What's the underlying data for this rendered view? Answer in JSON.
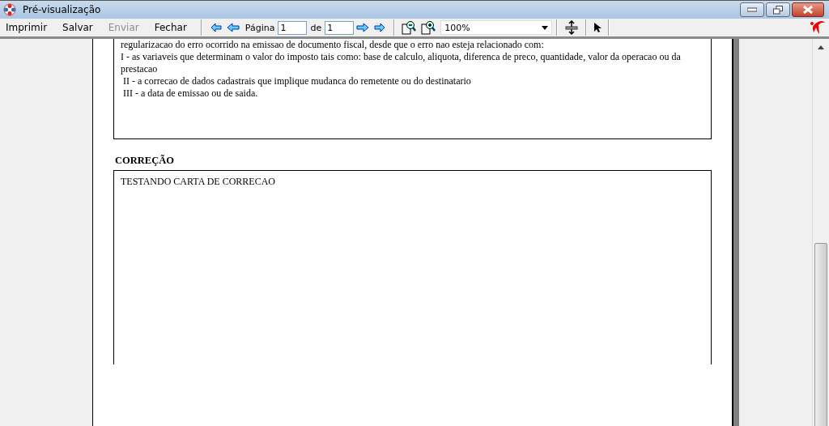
{
  "window": {
    "title": "Pré-visualização"
  },
  "toolbar": {
    "menu": [
      {
        "label": "Imprimir",
        "disabled": false
      },
      {
        "label": "Salvar",
        "disabled": false
      },
      {
        "label": "Enviar",
        "disabled": true
      },
      {
        "label": "Fechar",
        "disabled": false
      }
    ],
    "page_label": "Página",
    "page_value": "1",
    "of_label": "de",
    "page_count": "1",
    "zoom": "100%"
  },
  "document": {
    "text_lines": [
      "regularizacao do erro ocorrido na emissao de documento fiscal, desde que o erro nao esteja relacionado com:",
      "I - as variaveis que determinam o valor do imposto tais como: base de calculo, aliquota, diferenca de preco, quantidade, valor da operacao ou da prestacao",
      " II - a correcao de dados cadastrais que implique mudanca do remetente ou do destinatario",
      " III - a data de emissao ou de saida."
    ],
    "section_title": "CORREÇÃO",
    "correction_text": "TESTANDO CARTA DE CORRECAO"
  }
}
